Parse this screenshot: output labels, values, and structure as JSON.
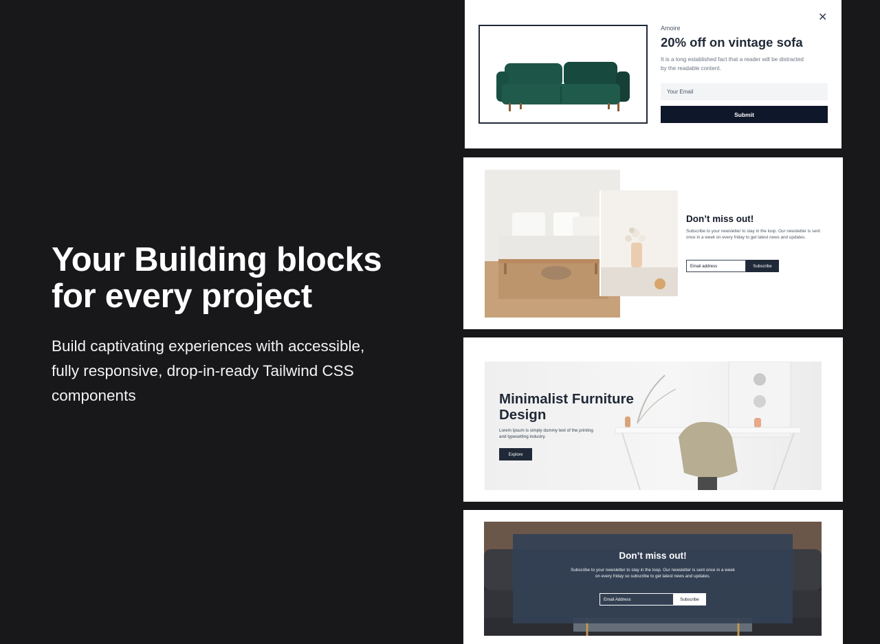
{
  "hero": {
    "title_line1": "Your Building blocks",
    "title_line2": "for every project",
    "subtitle": "Build captivating experiences with accessible, fully responsive, drop-in-ready Tailwind CSS components"
  },
  "promo_modal": {
    "close_icon": "close-icon",
    "brand": "Amoire",
    "title": "20% off on vintage sofa",
    "description": "It is a long established fact that a reader will be distracted by the readable content.",
    "email_placeholder": "Your Email",
    "submit_label": "Submit",
    "accent_color": "#0f172a",
    "image": "green-velvet-sofa"
  },
  "newsletter_split": {
    "title": "Don’t miss out!",
    "description": "Subscribe to your newsletter to stay in the loop. Our newsletter is sent once in a week on every friday to get latest news and updates.",
    "email_placeholder": "Email address",
    "subscribe_label": "Subscribe",
    "images": [
      "living-room-sofa",
      "vase-with-flowers"
    ]
  },
  "furniture_banner": {
    "title": "Minimalist Furniture Design",
    "description": "Lorem Ipsum is simply dummy text of the printing and typesetting industry.",
    "button_label": "Explore",
    "image": "desk-and-chair"
  },
  "newsletter_overlay": {
    "title": "Don’t miss out!",
    "description": "Subscribe to your newsletter to stay in the loop. Our newsletter is sent once in a week on every friday so subscribe to get latest news and updates.",
    "email_placeholder": "Email Address",
    "subscribe_label": "Subscribe",
    "image": "dark-tufted-sofa"
  }
}
